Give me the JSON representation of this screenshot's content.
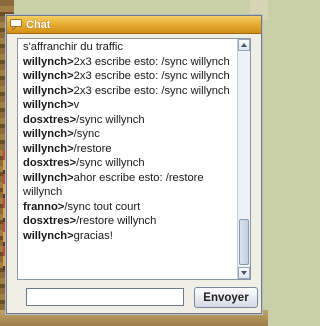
{
  "window": {
    "title": "Chat",
    "icon": "chat-bubble-icon"
  },
  "messages": [
    {
      "user": "",
      "text": "s'affranchir du traffic"
    },
    {
      "user": "willynch>",
      "text": "2x3 escribe esto: /sync willynch"
    },
    {
      "user": "willynch>",
      "text": "2x3 escribe esto: /sync willynch"
    },
    {
      "user": "willynch>",
      "text": "2x3 escribe esto: /sync willynch"
    },
    {
      "user": "willynch>",
      "text": "v"
    },
    {
      "user": "dosxtres>",
      "text": "/sync willynch"
    },
    {
      "user": "willynch>",
      "text": "/sync"
    },
    {
      "user": "willynch>",
      "text": "/restore"
    },
    {
      "user": "dosxtres>",
      "text": "/sync willynch"
    },
    {
      "user": "willynch>",
      "text": "ahor escribe esto: /restore willynch"
    },
    {
      "user": "franno>",
      "text": "/sync tout court"
    },
    {
      "user": "dosxtres>",
      "text": "/restore willynch"
    },
    {
      "user": "willynch>",
      "text": "gracias!"
    }
  ],
  "input": {
    "value": "",
    "placeholder": ""
  },
  "send_label": "Envoyer",
  "colors": {
    "title_bar": "#e6a92c",
    "title_text": "#ffffff",
    "window_bg": "#f0efe6"
  }
}
